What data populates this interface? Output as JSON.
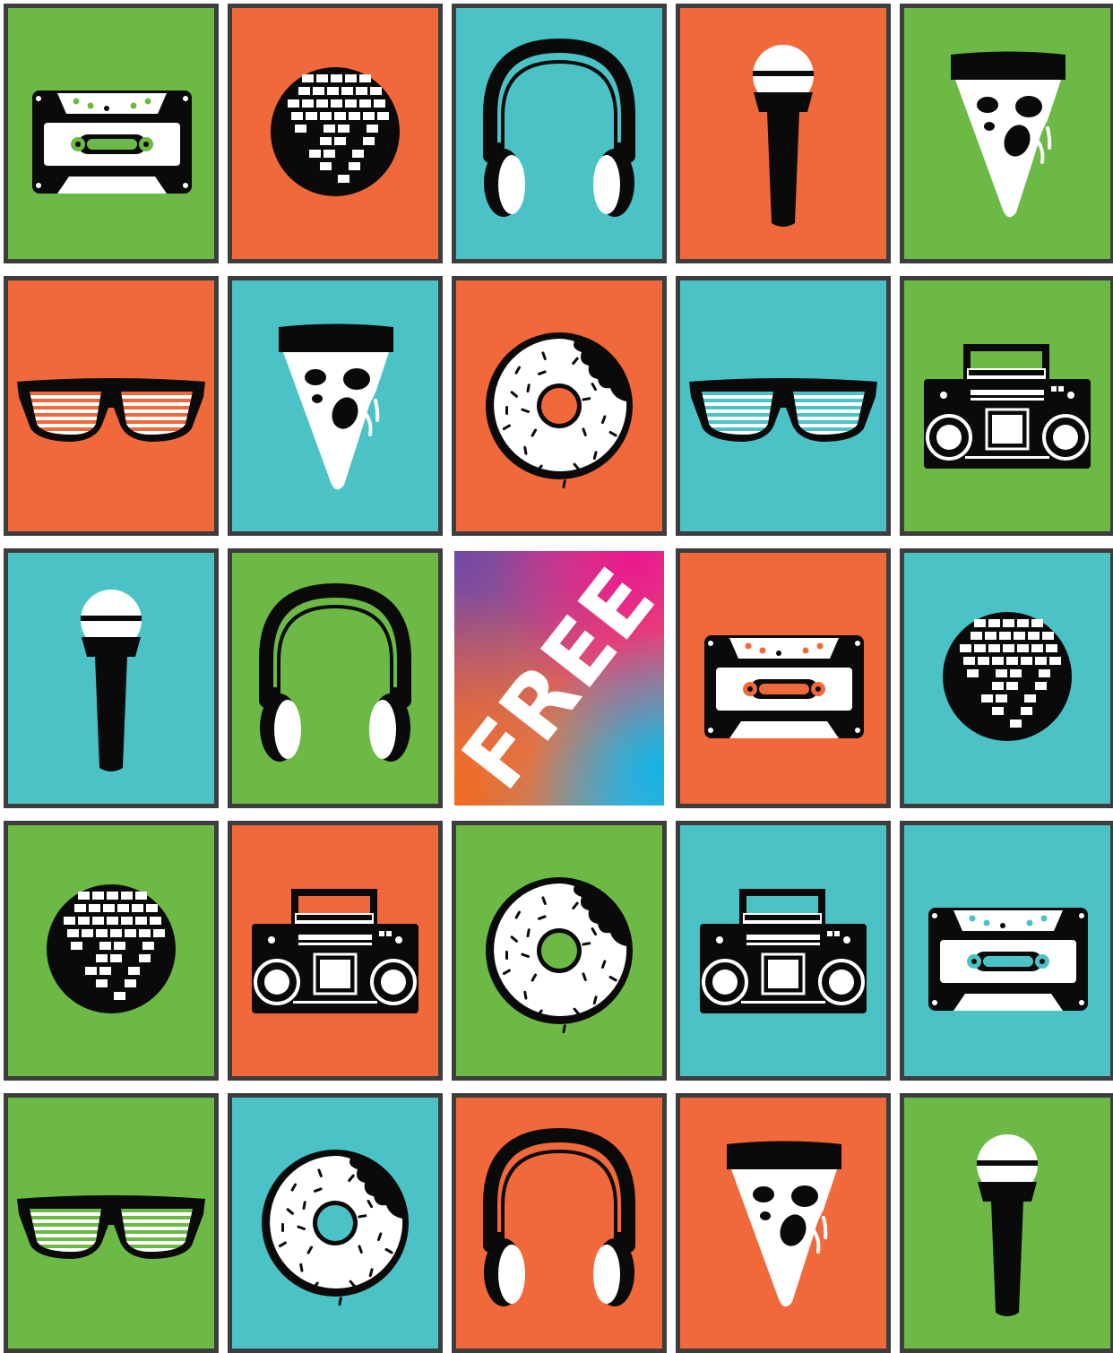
{
  "colors": {
    "green": "#6cba45",
    "orange": "#f1683b",
    "teal": "#4bc3c6",
    "border": "#3d3d3d",
    "ink": "#0a0a0a",
    "white": "#ffffff"
  },
  "free_space": {
    "label": "FREE"
  },
  "cells": [
    {
      "icon": "cassette-tape",
      "bg": "green"
    },
    {
      "icon": "disco-ball",
      "bg": "orange"
    },
    {
      "icon": "headphones",
      "bg": "teal"
    },
    {
      "icon": "microphone",
      "bg": "orange"
    },
    {
      "icon": "pizza-slice",
      "bg": "green"
    },
    {
      "icon": "shutter-shades",
      "bg": "orange"
    },
    {
      "icon": "pizza-slice",
      "bg": "teal"
    },
    {
      "icon": "donut",
      "bg": "orange"
    },
    {
      "icon": "shutter-shades",
      "bg": "teal"
    },
    {
      "icon": "boombox",
      "bg": "green"
    },
    {
      "icon": "microphone",
      "bg": "teal"
    },
    {
      "icon": "headphones",
      "bg": "green"
    },
    {
      "icon": "free",
      "bg": "free"
    },
    {
      "icon": "cassette-tape",
      "bg": "orange"
    },
    {
      "icon": "disco-ball",
      "bg": "teal"
    },
    {
      "icon": "disco-ball",
      "bg": "green"
    },
    {
      "icon": "boombox",
      "bg": "orange"
    },
    {
      "icon": "donut",
      "bg": "green"
    },
    {
      "icon": "boombox",
      "bg": "teal"
    },
    {
      "icon": "cassette-tape",
      "bg": "teal"
    },
    {
      "icon": "shutter-shades",
      "bg": "green"
    },
    {
      "icon": "donut",
      "bg": "teal"
    },
    {
      "icon": "headphones",
      "bg": "orange"
    },
    {
      "icon": "pizza-slice",
      "bg": "orange"
    },
    {
      "icon": "microphone",
      "bg": "green"
    }
  ]
}
